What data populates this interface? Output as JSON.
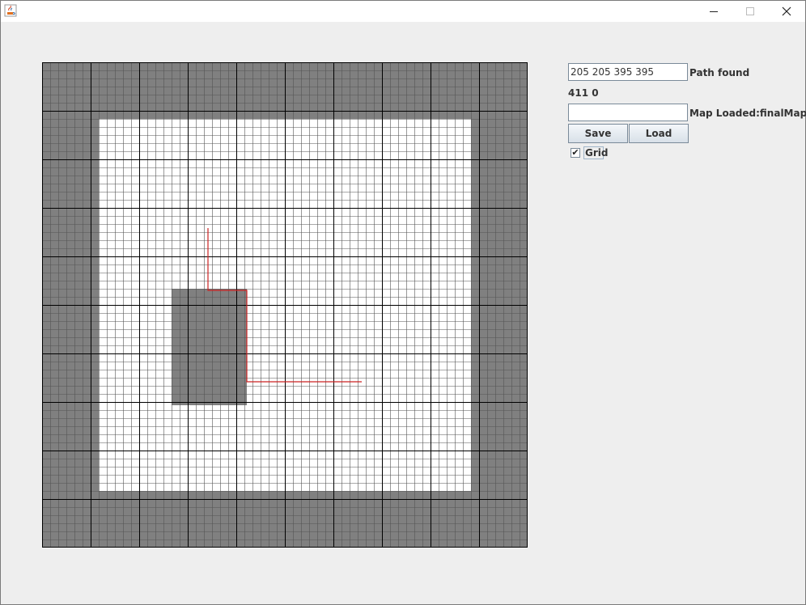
{
  "window": {
    "title": ""
  },
  "icons": {
    "app": "java-cup-icon",
    "minimize": "minimize-icon",
    "maximize": "maximize-icon",
    "close": "close-icon"
  },
  "panel": {
    "coords_value": "205 205 395 395",
    "status": "Path found",
    "position_readout": "411 0",
    "map_name_value": "",
    "map_status": "Map Loaded:finalMap",
    "save_label": "Save",
    "load_label": "Load",
    "grid_checkbox": {
      "label": "Grid",
      "checked": true,
      "mark": "✔"
    }
  },
  "map": {
    "colors": {
      "free": "#ffffff",
      "wall": "#808080",
      "path": "#cc2222",
      "fine_grid": "#555555",
      "major_grid": "#000000"
    },
    "grid_cells": 60,
    "major_every": 6,
    "obstacles": [
      {
        "name": "outer-wall-top",
        "col": 0,
        "row": 0,
        "cols": 60,
        "rows": 7
      },
      {
        "name": "outer-wall-bottom",
        "col": 0,
        "row": 53,
        "cols": 60,
        "rows": 7
      },
      {
        "name": "outer-wall-left",
        "col": 0,
        "row": 7,
        "cols": 7,
        "rows": 46
      },
      {
        "name": "outer-wall-right",
        "col": 53,
        "row": 7,
        "cols": 7,
        "rows": 46
      },
      {
        "name": "obstacle-block",
        "col": 16,
        "row": 28,
        "cols": 9.3,
        "rows": 14.4
      }
    ],
    "path": [
      [
        20.5,
        20.5
      ],
      [
        20.5,
        28.2
      ],
      [
        25.3,
        28.2
      ],
      [
        25.3,
        39.5
      ],
      [
        39.5,
        39.5
      ]
    ]
  }
}
